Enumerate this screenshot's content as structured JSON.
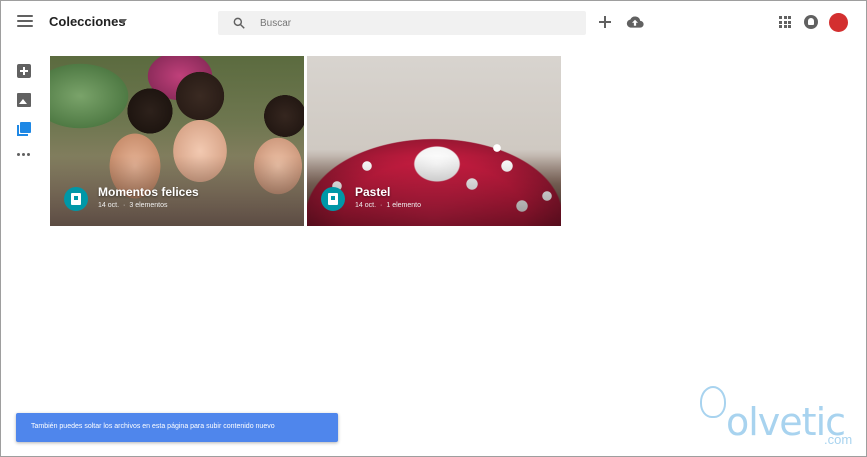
{
  "header": {
    "title": "Colecciones",
    "search_placeholder": "Buscar"
  },
  "rail": {
    "items": [
      {
        "icon": "create-icon"
      },
      {
        "icon": "photos-icon"
      },
      {
        "icon": "collections-icon",
        "active": true
      },
      {
        "icon": "more-icon"
      }
    ]
  },
  "collections": [
    {
      "title": "Momentos felices",
      "date": "14 oct.",
      "count": "3 elementos"
    },
    {
      "title": "Pastel",
      "date": "14 oct.",
      "count": "1 elemento"
    }
  ],
  "snackbar": {
    "text": "También puedes soltar los archivos en esta página para subir contenido nuevo"
  },
  "watermark": {
    "text": "olvetic",
    "suffix": ".com"
  },
  "colors": {
    "accent": "#1e88e5",
    "badge": "#0097a7",
    "snackbar": "#4f86ec",
    "avatar": "#d32f2f"
  }
}
